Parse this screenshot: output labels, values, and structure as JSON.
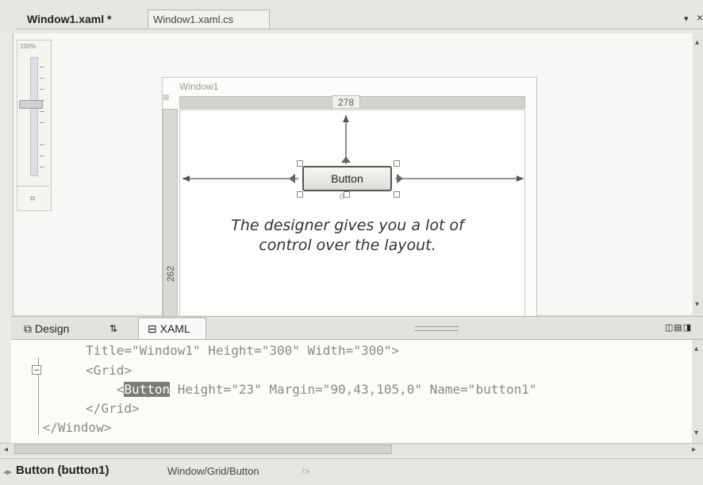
{
  "document_tabs": {
    "active_label": "Window1.xaml *",
    "inactive_label": "Window1.xaml.cs"
  },
  "window_controls": {
    "dropdown_glyph": "▾",
    "close_glyph": "×"
  },
  "zoom": {
    "label": "100%",
    "fit_glyph": "⌗",
    "level_fraction": 0.6
  },
  "designer": {
    "window_title": "Window1",
    "ruler_width_value": "278",
    "ruler_height_value": "262",
    "button_label": "Button",
    "button_below_value": "0",
    "annotation_text": "The designer gives you a lot of control over the layout."
  },
  "view_tabs": {
    "design_label": "Design",
    "swap_glyph": "⇅",
    "xaml_label": "XAML",
    "pane_buttons": "◫▤◨"
  },
  "code": {
    "line1": "     Title=\"Window1\" Height=\"300\" Width=\"300\">",
    "line2_indent": "     ",
    "line2_tag": "<Grid>",
    "line3_indent": "         <",
    "line3_selected": "Button",
    "line3_rest": " Height=\"23\" Margin=\"90,43,105,0\" Name=\"button1\"",
    "line4": "     </Grid>",
    "line5": " </Window>",
    "collapse_glyph": "−"
  },
  "status": {
    "nav_glyph": "◂▸",
    "element_label": "Button (button1)",
    "path": "Window/Grid/Button",
    "end_marker": "/>"
  },
  "colors": {
    "selection": "#7a7a76",
    "window_frame": "#c6c6c2",
    "background": "#e9e9e6"
  }
}
